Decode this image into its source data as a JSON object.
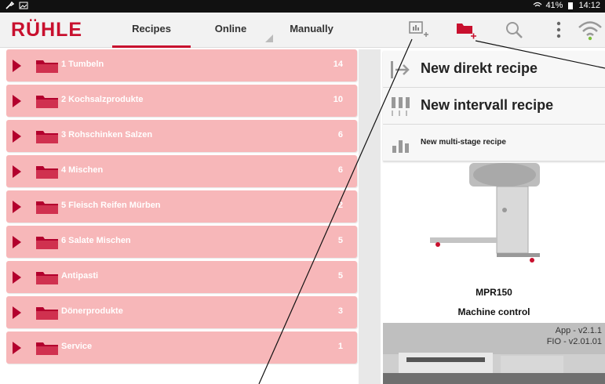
{
  "statusbar": {
    "battery": "41%",
    "time": "14:12"
  },
  "tabs": [
    {
      "label": "Recipes"
    },
    {
      "label": "Online"
    },
    {
      "label": "Manually"
    }
  ],
  "folders": [
    {
      "name": "1 Tumbeln",
      "count": "14"
    },
    {
      "name": "2 Kochsalzprodukte",
      "count": "10"
    },
    {
      "name": "3 Rohschinken Salzen",
      "count": "6"
    },
    {
      "name": "4 Mischen",
      "count": "6"
    },
    {
      "name": "5 Fleisch Reifen Mürben",
      "count": "2"
    },
    {
      "name": "6 Salate Mischen",
      "count": "5"
    },
    {
      "name": "Antipasti",
      "count": "5"
    },
    {
      "name": "Dönerprodukte",
      "count": "3"
    },
    {
      "name": "Service",
      "count": "1"
    }
  ],
  "menu": {
    "direct": "New direkt recipe",
    "interval": "New intervall recipe",
    "multistage": "New multi-stage recipe"
  },
  "machine": {
    "name": "MPR150",
    "control": "Machine control"
  },
  "versions": {
    "app": "App - v2.1.1",
    "fio": "FIO - v2.01.01"
  },
  "colors": {
    "brand": "#c8102e",
    "row": "#f7b7b9",
    "arrow": "#b3002d"
  },
  "icons": [
    "wrench-icon",
    "image-icon",
    "add-recipe-icon",
    "add-folder-icon",
    "search-icon",
    "more-icon",
    "wifi-icon",
    "folder-icon",
    "expand-arrow-icon"
  ]
}
